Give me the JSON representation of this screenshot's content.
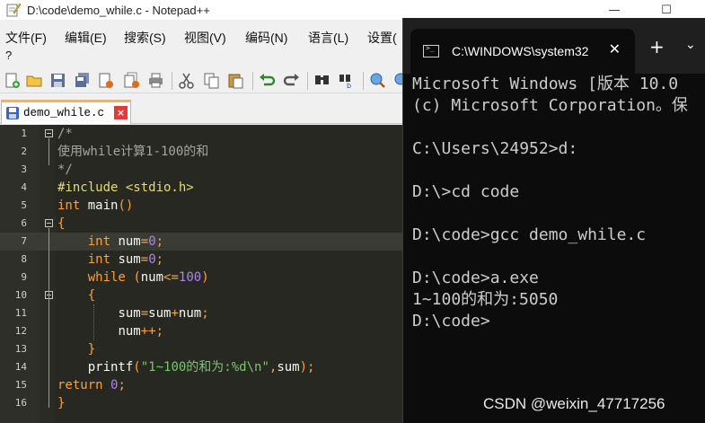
{
  "notepad": {
    "title": "D:\\code\\demo_while.c - Notepad++",
    "menu": [
      "文件(F)",
      "编辑(E)",
      "搜索(S)",
      "视图(V)",
      "编码(N)",
      "语言(L)",
      "设置("
    ],
    "menu_overflow": "?",
    "tab_label": "demo_while.c",
    "tab_close": "×",
    "window_buttons": {
      "minimize": "—",
      "maximize": "☐"
    },
    "toolbar_icons": [
      "new-file-icon",
      "open-folder-icon",
      "save-icon",
      "save-all-icon",
      "close-icon",
      "close-all-icon",
      "print-icon",
      "cut-icon",
      "copy-icon",
      "paste-icon",
      "undo-icon",
      "redo-icon",
      "find-icon",
      "replace-icon",
      "zoom-in-icon"
    ],
    "line_numbers": [
      "1",
      "2",
      "3",
      "4",
      "5",
      "6",
      "7",
      "8",
      "9",
      "10",
      "11",
      "12",
      "13",
      "14",
      "15",
      "16"
    ]
  },
  "terminal": {
    "tab_title": "C:\\WINDOWS\\system32",
    "tab_close": "✕",
    "new_tab": "+",
    "dropdown": "⌄",
    "lines": [
      "Microsoft Windows [版本 10.0",
      "(c) Microsoft Corporation。保",
      "",
      "C:\\Users\\24952>d:",
      "",
      "D:\\>cd code",
      "",
      "D:\\code>gcc demo_while.c",
      "",
      "D:\\code>a.exe",
      "1~100的和为:5050",
      "D:\\code>"
    ]
  },
  "watermark": "CSDN @weixin_47717256",
  "colors": {
    "editor_bg": "#272822",
    "terminal_bg": "#0c0c0c",
    "keyword": "#f6a33a",
    "string": "#76c86b",
    "number": "#ae81ff",
    "preprocessor": "#e6db74",
    "comment": "#a6a6a0"
  }
}
